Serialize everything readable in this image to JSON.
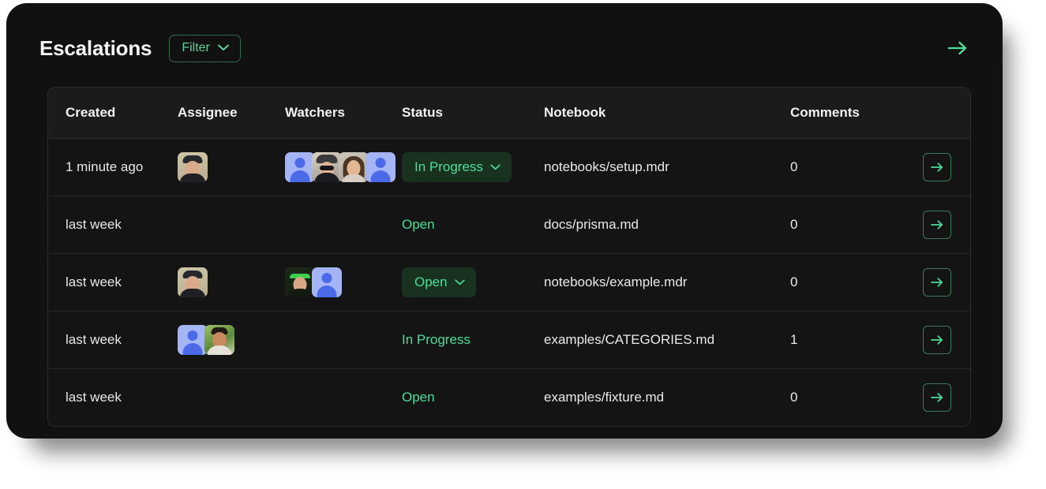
{
  "card": {
    "title": "Escalations",
    "filter_label": "Filter",
    "filter_chevron_icon": "chevron-down-icon",
    "header_arrow_icon": "arrow-right-icon"
  },
  "table": {
    "columns": [
      "Created",
      "Assignee",
      "Watchers",
      "Status",
      "Notebook",
      "Comments"
    ],
    "row_action_icon": "arrow-right-icon",
    "status_chevron_icon": "chevron-down-icon",
    "rows": [
      {
        "created": "1 minute ago",
        "assignees": [
          {
            "kind": "photo",
            "style": "pA",
            "name": "avatar-person-capped"
          }
        ],
        "watchers": [
          {
            "kind": "placeholder",
            "name": "avatar-placeholder"
          },
          {
            "kind": "photo",
            "style": "pB",
            "name": "avatar-person-hat-sunglasses"
          },
          {
            "kind": "photo",
            "style": "pC",
            "name": "avatar-person-long-hair"
          },
          {
            "kind": "placeholder",
            "name": "avatar-placeholder"
          }
        ],
        "status": "In Progress",
        "status_style": "badge",
        "notebook": "notebooks/setup.mdr",
        "comments": "0"
      },
      {
        "created": "last week",
        "assignees": [],
        "watchers": [],
        "status": "Open",
        "status_style": "plain",
        "notebook": "docs/prisma.md",
        "comments": "0"
      },
      {
        "created": "last week",
        "assignees": [
          {
            "kind": "photo",
            "style": "pA",
            "name": "avatar-person-capped"
          }
        ],
        "watchers": [
          {
            "kind": "photo",
            "style": "pD",
            "name": "avatar-person-green-headband"
          },
          {
            "kind": "placeholder",
            "name": "avatar-placeholder"
          }
        ],
        "status": "Open",
        "status_style": "badge",
        "notebook": "notebooks/example.mdr",
        "comments": "0"
      },
      {
        "created": "last week",
        "assignees": [
          {
            "kind": "placeholder",
            "name": "avatar-placeholder"
          },
          {
            "kind": "photo",
            "style": "pE",
            "name": "avatar-person-foliage"
          }
        ],
        "watchers": [],
        "status": "In Progress",
        "status_style": "plain",
        "notebook": "examples/CATEGORIES.md",
        "comments": "1"
      },
      {
        "created": "last week",
        "assignees": [],
        "watchers": [],
        "status": "Open",
        "status_style": "plain",
        "notebook": "examples/fixture.md",
        "comments": "0"
      }
    ]
  },
  "colors": {
    "page_background": "#ffffff",
    "card_background": "#111111",
    "table_background": "#141414",
    "table_header_background": "#1b1b1b",
    "border": "#2b2b2b",
    "accent_green": "#4ade9a",
    "badge_background": "#19321f",
    "text_primary": "#f2f2f2"
  }
}
